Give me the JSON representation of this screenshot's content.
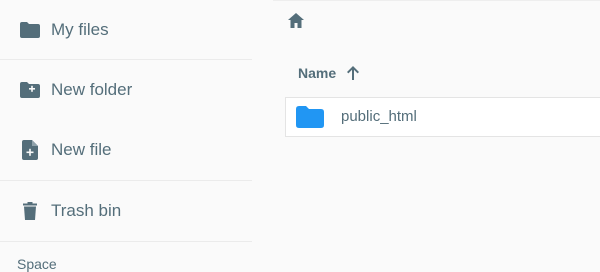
{
  "sidebar": {
    "items": [
      {
        "label": "My files",
        "icon": "folder-icon"
      },
      {
        "label": "New folder",
        "icon": "create-new-folder-icon"
      },
      {
        "label": "New file",
        "icon": "note-add-icon"
      },
      {
        "label": "Trash bin",
        "icon": "delete-icon"
      }
    ],
    "section_label": "Space"
  },
  "toolbar": {
    "home_icon": "home-icon"
  },
  "list": {
    "column_header": "Name",
    "sort_icon": "arrow-upward-icon",
    "rows": [
      {
        "name": "public_html",
        "icon": "folder-icon"
      }
    ]
  },
  "colors": {
    "icon_gray": "#546e7a",
    "folder_blue": "#2196f3"
  }
}
